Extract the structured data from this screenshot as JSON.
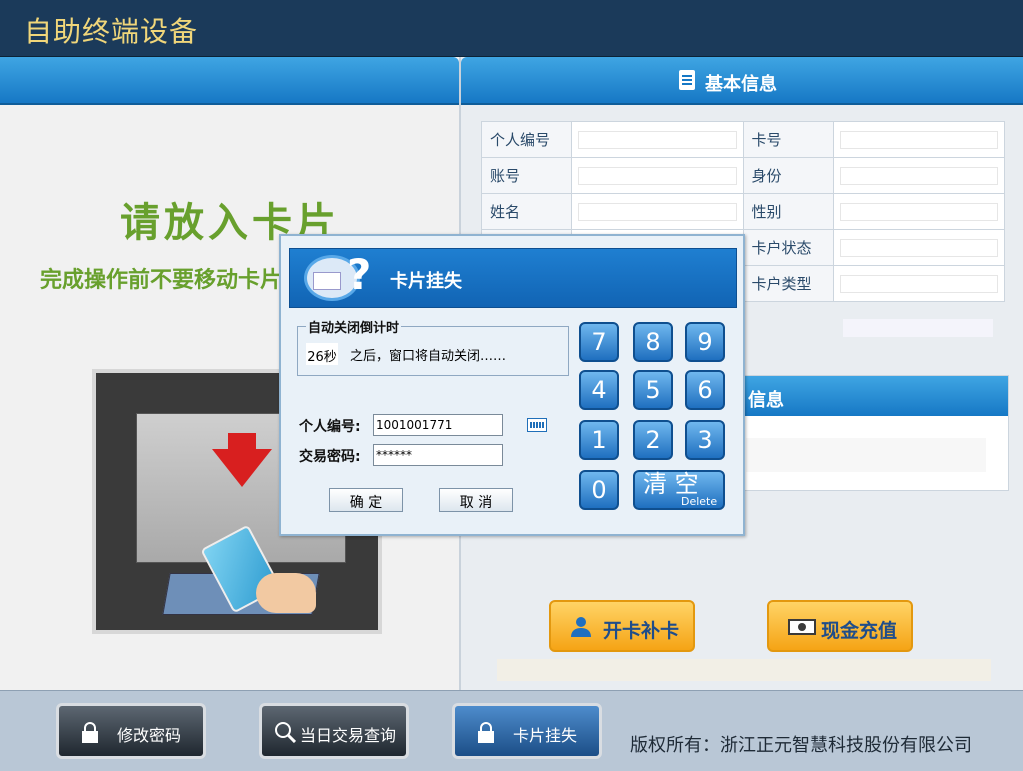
{
  "app": {
    "title": "自助终端设备"
  },
  "left": {
    "insert_text": "请放入卡片",
    "notice_text": "完成操作前不要移动卡片"
  },
  "info": {
    "header": "基本信息",
    "rows": [
      {
        "l1": "个人编号",
        "v1": "",
        "l2": "卡号",
        "v2": ""
      },
      {
        "l1": "账号",
        "v1": "",
        "l2": "身份",
        "v2": ""
      },
      {
        "l1": "姓名",
        "v1": "",
        "l2": "性别",
        "v2": ""
      },
      {
        "l1": "",
        "v1": "",
        "l2": "卡户状态",
        "v2": ""
      },
      {
        "l1": "",
        "v1": "",
        "l2": "卡户类型",
        "v2": ""
      }
    ]
  },
  "secondary": {
    "header_visible": "信息"
  },
  "actions": {
    "open_card": "开卡补卡",
    "cash_topup": "现金充值"
  },
  "dialog": {
    "title": "卡片挂失",
    "auto_close_legend": "自动关闭倒计时",
    "countdown": "26秒",
    "countdown_text": "之后，窗口将自动关闭……",
    "person_label": "个人编号:",
    "person_value": "1001001771",
    "pwd_label": "交易密码:",
    "pwd_value": "******",
    "ok": "确 定",
    "cancel": "取 消",
    "keys": [
      "7",
      "8",
      "9",
      "4",
      "5",
      "6",
      "1",
      "2",
      "3",
      "0"
    ],
    "clear": "清 空",
    "clear_sub": "Delete"
  },
  "bottom": {
    "change_pwd": "修改密码",
    "today_query": "当日交易查询",
    "card_loss": "卡片挂失",
    "copyright": "版权所有：浙江正元智慧科技股份有限公司"
  },
  "colors": {
    "header_blue": "#1678c5",
    "green_text": "#68a02d",
    "orange": "#f5a415",
    "title_yellow": "#f0d67a"
  }
}
